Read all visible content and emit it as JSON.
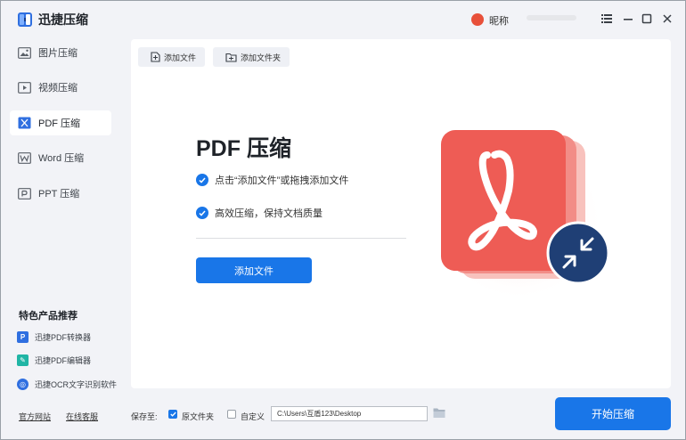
{
  "app": {
    "title": "迅捷压缩"
  },
  "user": {
    "name": "昵称"
  },
  "sidebar": {
    "items": [
      {
        "label": "图片压缩"
      },
      {
        "label": "视频压缩"
      },
      {
        "label": "PDF 压缩"
      },
      {
        "label": "Word 压缩"
      },
      {
        "label": "PPT 压缩"
      }
    ],
    "section_title": "特色产品推荐",
    "products": [
      {
        "label": "迅捷PDF转换器"
      },
      {
        "label": "迅捷PDF编辑器"
      },
      {
        "label": "迅捷OCR文字识别软件"
      }
    ],
    "footer": {
      "website": "官方网站",
      "support": "在线客服"
    }
  },
  "toolbar": {
    "add_file": "添加文件",
    "add_folder": "添加文件夹"
  },
  "main": {
    "title": "PDF 压缩",
    "tips": [
      "点击“添加文件”或拖拽添加文件",
      "高效压缩，保持文档质量"
    ],
    "add_file_button": "添加文件"
  },
  "bottom": {
    "save_to_label": "保存至:",
    "option_source_folder": "原文件夹",
    "option_custom": "自定义",
    "path_value": "C:\\Users\\互盾123\\Desktop",
    "start_button": "开始压缩"
  },
  "colors": {
    "accent": "#1976e8",
    "pdf_red": "#ee5c55",
    "badge_navy": "#1f3f75"
  }
}
